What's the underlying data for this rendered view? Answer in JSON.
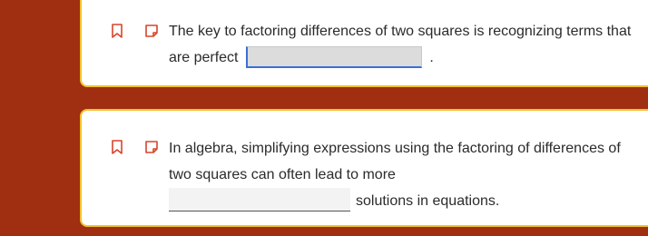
{
  "colors": {
    "background": "#a02e10",
    "card_border": "#f2c12e",
    "icon_color": "#d9452b",
    "focus_blue": "#3a6fd8"
  },
  "questions": [
    {
      "icons": [
        "bookmark-icon",
        "note-icon"
      ],
      "text_before": "The key to factoring differences of two squares is recognizing terms that are perfect",
      "blank_value": "",
      "text_after": "."
    },
    {
      "icons": [
        "bookmark-icon",
        "note-icon"
      ],
      "text_before": "In algebra, simplifying expressions using the factoring of differences of two squares can often lead to more",
      "blank_value": "",
      "text_after": "solutions in equations."
    }
  ]
}
